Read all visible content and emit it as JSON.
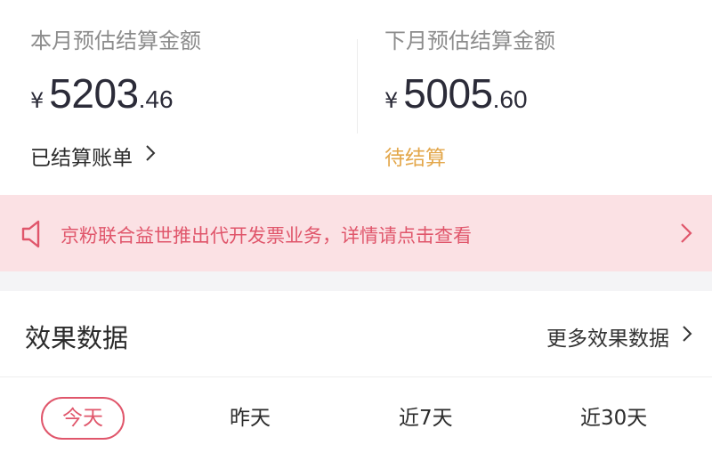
{
  "settlement": {
    "this_month": {
      "label": "本月预估结算金额",
      "currency": "¥",
      "amount_int": "5203",
      "amount_dec": ".46",
      "link": "已结算账单"
    },
    "next_month": {
      "label": "下月预估结算金额",
      "currency": "¥",
      "amount_int": "5005",
      "amount_dec": ".60",
      "status": "待结算"
    }
  },
  "notice": {
    "icon": "speaker-icon",
    "text": "京粉联合益世推出代开发票业务，详情请点击查看"
  },
  "performance": {
    "title": "效果数据",
    "more_label": "更多效果数据",
    "tabs": [
      "今天",
      "昨天",
      "近7天",
      "近30天"
    ],
    "active_tab": "今天"
  },
  "colors": {
    "accent": "#e0566b",
    "banner_bg": "#fbe1e4",
    "pending": "#e3a74b",
    "muted": "#8c8c8c"
  }
}
